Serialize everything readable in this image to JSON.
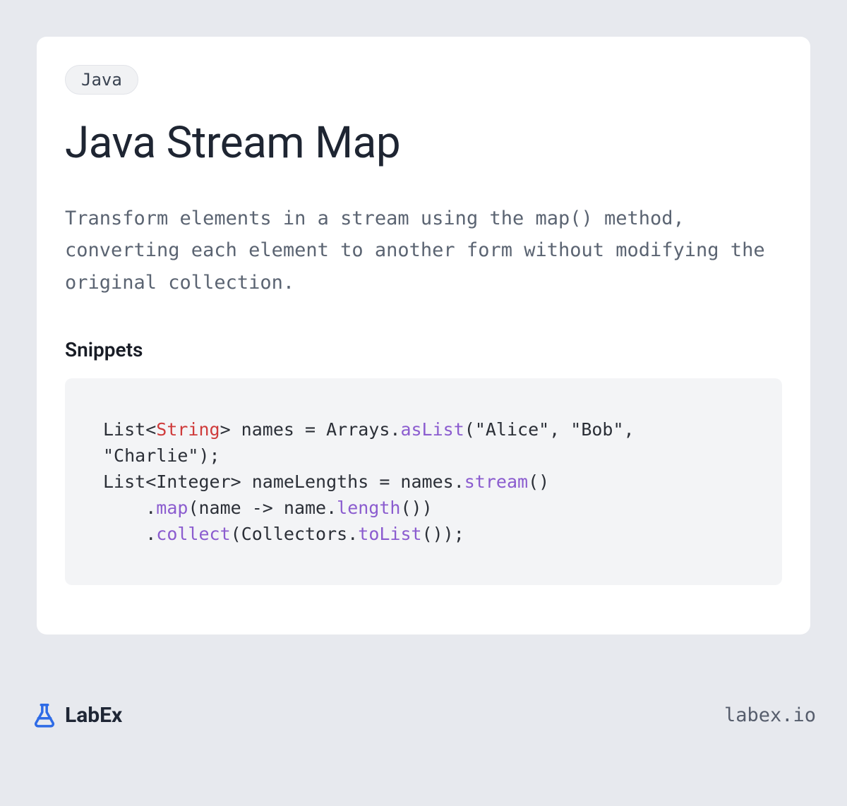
{
  "tag": "Java",
  "title": "Java Stream Map",
  "description": "Transform elements in a stream using the map() method, converting each element to another form without modifying the original collection.",
  "section_heading": "Snippets",
  "code": {
    "tokens": [
      {
        "t": "List<",
        "c": ""
      },
      {
        "t": "String",
        "c": "tok-type"
      },
      {
        "t": "> names = Arrays.",
        "c": ""
      },
      {
        "t": "asList",
        "c": "tok-method"
      },
      {
        "t": "(\"Alice\", \"Bob\", \"Charlie\");\nList<Integer> nameLengths = names.",
        "c": ""
      },
      {
        "t": "stream",
        "c": "tok-method"
      },
      {
        "t": "()\n    .",
        "c": ""
      },
      {
        "t": "map",
        "c": "tok-method"
      },
      {
        "t": "(name -> name.",
        "c": ""
      },
      {
        "t": "length",
        "c": "tok-method"
      },
      {
        "t": "())\n    .",
        "c": ""
      },
      {
        "t": "collect",
        "c": "tok-method"
      },
      {
        "t": "(Collectors.",
        "c": ""
      },
      {
        "t": "toList",
        "c": "tok-method"
      },
      {
        "t": "());",
        "c": ""
      }
    ]
  },
  "brand": {
    "name": "LabEx",
    "url": "labex.io"
  }
}
